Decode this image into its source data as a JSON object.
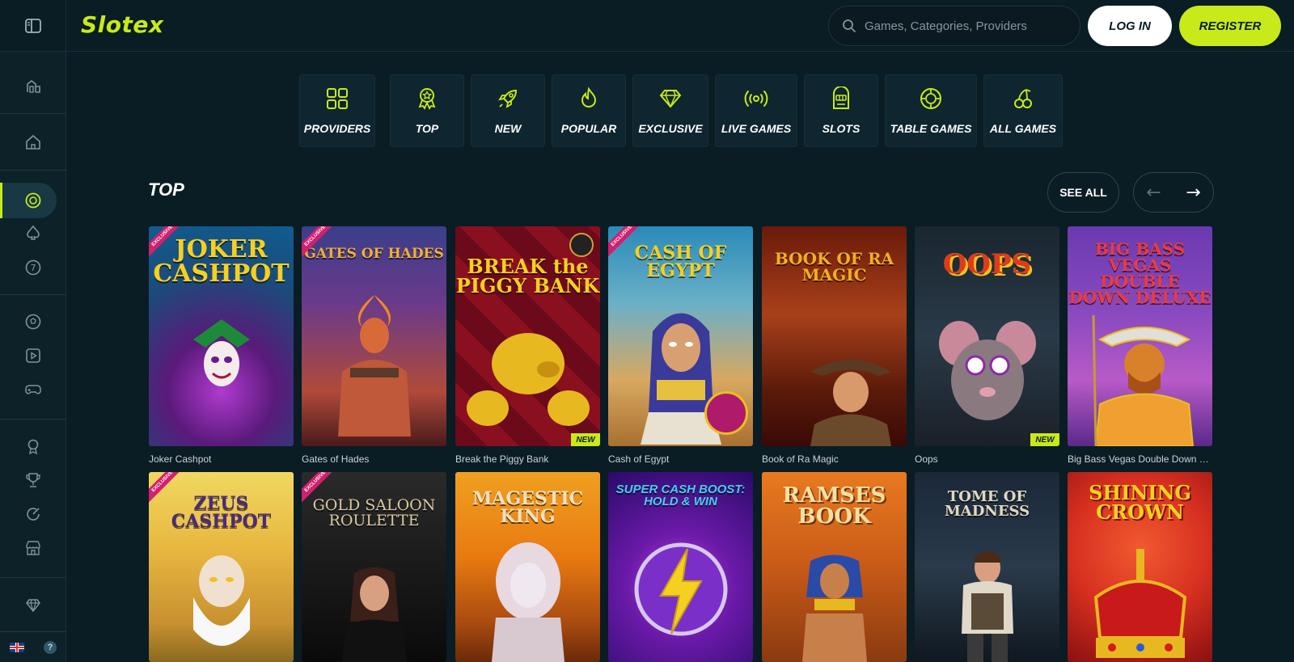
{
  "brand": {
    "logo": "Slotex",
    "accent": "#c8ea1a"
  },
  "search": {
    "placeholder": "Games, Categories, Providers"
  },
  "auth": {
    "login": "LOG IN",
    "register": "REGISTER"
  },
  "sidebar": {
    "icons": [
      "bank-icon",
      "home-icon",
      "casino-chip-icon",
      "spade-icon",
      "seven-icon",
      "football-icon",
      "play-icon",
      "gamepad-icon",
      "medal-icon",
      "trophy-icon",
      "refresh-icon",
      "store-icon",
      "diamond-icon"
    ],
    "language": "EN",
    "help": "?"
  },
  "categories": [
    {
      "label": "PROVIDERS",
      "icon": "grid-icon"
    },
    {
      "label": "TOP",
      "icon": "award-icon"
    },
    {
      "label": "NEW",
      "icon": "rocket-icon"
    },
    {
      "label": "POPULAR",
      "icon": "flame-icon"
    },
    {
      "label": "EXCLUSIVE",
      "icon": "diamond-icon"
    },
    {
      "label": "LIVE GAMES",
      "icon": "live-icon"
    },
    {
      "label": "SLOTS",
      "icon": "slot-machine-icon"
    },
    {
      "label": "TABLE GAMES",
      "icon": "chip-icon"
    },
    {
      "label": "ALL GAMES",
      "icon": "cherries-icon"
    }
  ],
  "section": {
    "title": "TOP",
    "see_all": "SEE ALL",
    "prev": "←",
    "next": "→"
  },
  "games_row1": [
    {
      "name": "Joker Cashpot",
      "art_title": "JOKER CASHPOT",
      "exclusive": "EXCLUSIVE",
      "new": ""
    },
    {
      "name": "Gates of Hades",
      "art_title": "GATES OF HADES",
      "exclusive": "EXCLUSIVE",
      "new": ""
    },
    {
      "name": "Break the Piggy Bank",
      "art_title": "BREAK the PIGGY BANK",
      "exclusive": "",
      "new": "NEW"
    },
    {
      "name": "Cash of Egypt",
      "art_title": "CASH OF EGYPT",
      "exclusive": "EXCLUSIVE",
      "new": ""
    },
    {
      "name": "Book of Ra Magic",
      "art_title": "BOOK OF RA MAGIC",
      "exclusive": "",
      "new": ""
    },
    {
      "name": "Oops",
      "art_title": "OOPS",
      "exclusive": "",
      "new": "NEW"
    },
    {
      "name": "Big Bass Vegas Double Down D...",
      "art_title": "BIG BASS VEGAS DOUBLE DOWN DELUXE",
      "exclusive": "",
      "new": ""
    }
  ],
  "games_row2": [
    {
      "art_title": "ZEUS CASHPOT",
      "exclusive": "EXCLUSIVE"
    },
    {
      "art_title": "GOLD SALOON ROULETTE",
      "exclusive": "EXCLUSIVE"
    },
    {
      "art_title": "MAGESTIC KING",
      "exclusive": ""
    },
    {
      "art_title": "SUPER CASH BOOST: HOLD & WIN",
      "exclusive": ""
    },
    {
      "art_title": "RAMSES BOOK",
      "exclusive": ""
    },
    {
      "art_title": "TOME OF MADNESS",
      "exclusive": ""
    },
    {
      "art_title": "SHINING CROWN",
      "exclusive": ""
    }
  ]
}
